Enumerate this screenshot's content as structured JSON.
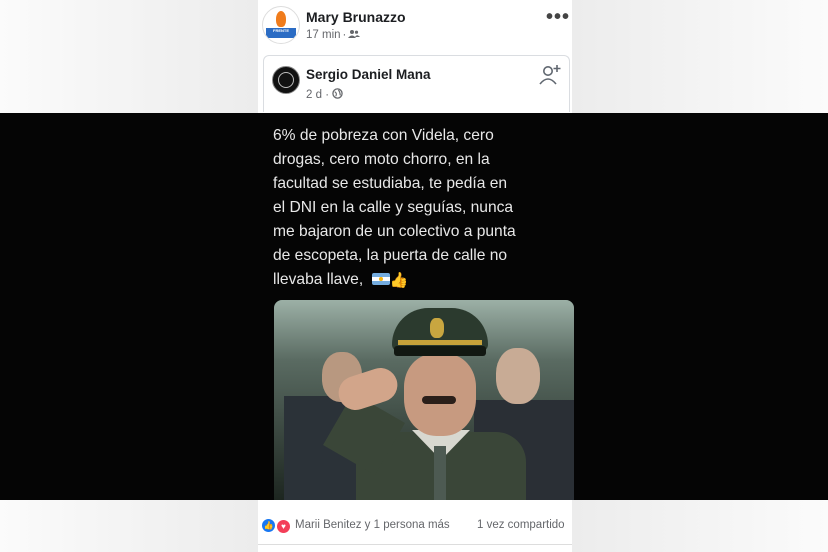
{
  "post": {
    "author": "Mary Brunazzo",
    "time": "17 min",
    "avatar_text": "FRENTE"
  },
  "shared_post": {
    "author": "Sergio Daniel Mana",
    "time": "2 d",
    "text_lines": [
      "6% de pobreza con Videla, cero",
      "drogas, cero moto chorro, en la",
      "facultad se estudiaba, te pedía en",
      "el DNI en la calle y seguías, nunca",
      "me bajaron de un colectivo a punta",
      "de escopeta, la puerta de calle no",
      "llevaba llave,"
    ]
  },
  "footer": {
    "reactors": "Marii Benitez y 1 persona más",
    "shares": "1 vez compartido"
  },
  "icons": [
    "more-options-icon",
    "friends-audience-icon",
    "globe-icon",
    "add-friend-icon",
    "like-reaction-icon",
    "love-reaction-icon",
    "argentina-flag-emoji",
    "thumbs-up-emoji"
  ],
  "colors": {
    "like": "#1877f2",
    "love": "#f33e58",
    "name": "#1c1e21",
    "meta": "#65676b"
  }
}
